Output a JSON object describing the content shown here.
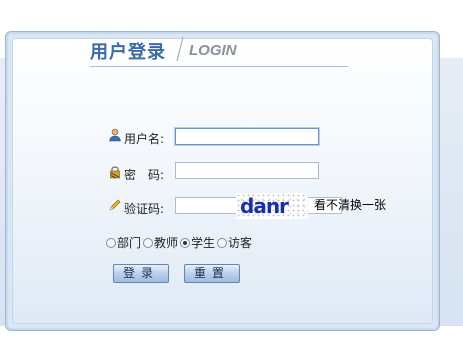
{
  "header": {
    "title_zh": "用户登录",
    "title_en": "LOGIN"
  },
  "form": {
    "username": {
      "label": "用户名:",
      "value": ""
    },
    "password": {
      "label": "密　码:",
      "value": ""
    },
    "captcha": {
      "label": "验证码:",
      "value": "",
      "image_text": "danr",
      "refresh_text": "看不清换一张"
    },
    "roles": [
      {
        "label": "部门",
        "checked": false
      },
      {
        "label": "教师",
        "checked": false
      },
      {
        "label": "学生",
        "checked": true
      },
      {
        "label": "访客",
        "checked": false
      }
    ]
  },
  "buttons": {
    "login": "登录",
    "reset": "重置"
  },
  "colors": {
    "title": "#3a6aa8",
    "captcha_text": "#1a2fb0",
    "panel_bg": "#dbe6f3"
  },
  "icons": [
    "user-icon",
    "lock-icon",
    "pencil-icon"
  ]
}
